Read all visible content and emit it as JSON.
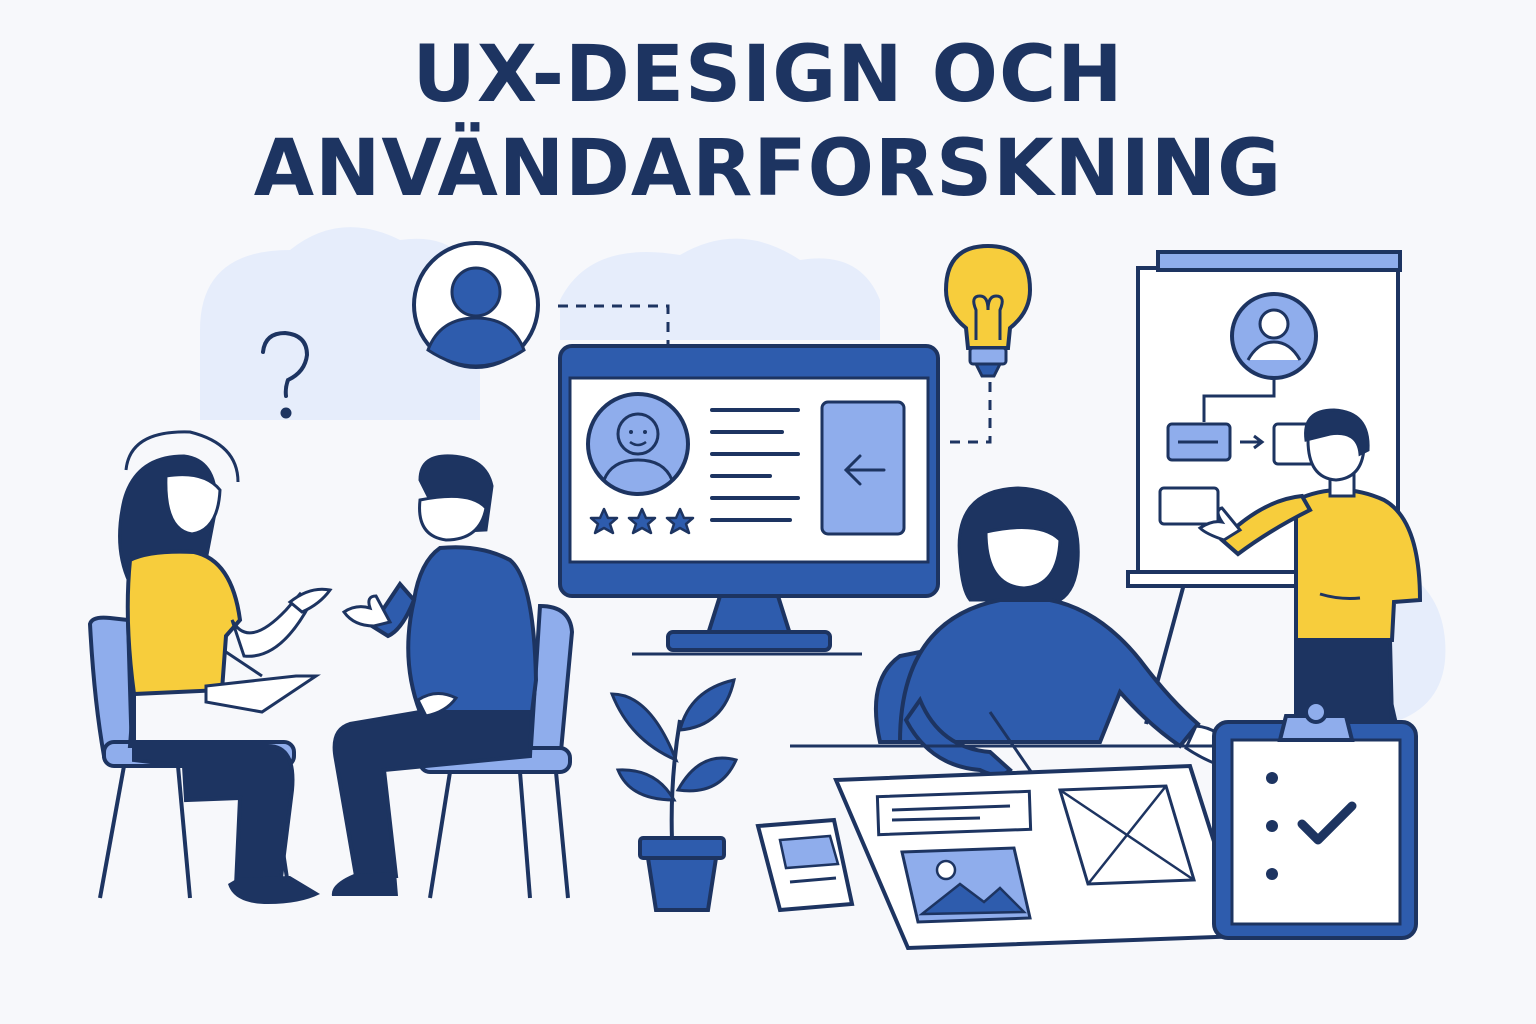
{
  "heading": {
    "line1": "UX-DESIGN OCH",
    "line2": "ANVÄNDARFORSKNING"
  },
  "colors": {
    "navy": "#1d3461",
    "blue": "#2e5cad",
    "light_blue": "#8fadec",
    "yellow": "#f7cd3c",
    "background": "#f7f8fb",
    "cloud": "#e6edfb"
  },
  "icons": [
    "question-mark-icon",
    "user-avatar-icon",
    "lightbulb-icon",
    "monitor-icon",
    "smiley-profile-icon",
    "star-icon",
    "arrow-left-icon",
    "flipchart-icon",
    "clipboard-checklist-icon",
    "checkmark-icon",
    "image-placeholder-icon",
    "potted-plant-icon"
  ]
}
